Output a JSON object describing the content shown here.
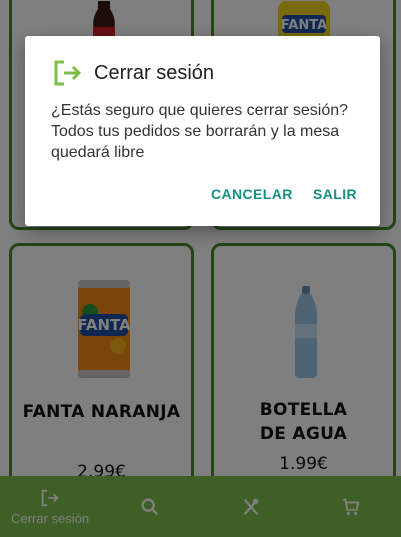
{
  "products": [
    {
      "name": "",
      "price": ""
    },
    {
      "name": "",
      "price": ""
    },
    {
      "name": "FANTA NARANJA",
      "price": "2.99€"
    },
    {
      "name": "BOTELLA DE AGUA",
      "price": "1.99€"
    }
  ],
  "bottom_nav": {
    "logout_label": "Cerrar sesión",
    "icons": [
      "logout-icon",
      "search-icon",
      "restaurant-icon",
      "cart-icon"
    ]
  },
  "dialog": {
    "title": "Cerrar sesión",
    "message": "¿Estás seguro que quieres cerrar sesión? Todos tus pedidos se borrarán y la mesa quedará libre",
    "cancel_label": "CANCELAR",
    "confirm_label": "SALIR"
  },
  "colors": {
    "accent_green": "#7cbf4a",
    "card_border": "#4d8a2e",
    "dialog_button": "#15907e"
  }
}
